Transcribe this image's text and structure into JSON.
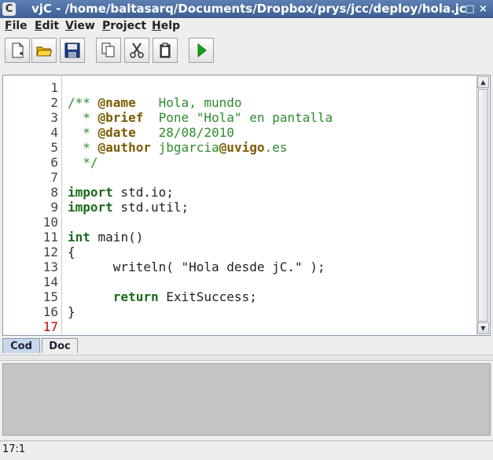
{
  "window": {
    "app_icon": "C",
    "title": "vjC - /home/baltasarq/Documents/Dropbox/prys/jcc/deploy/hola.jc",
    "controls": [
      "_",
      "□",
      "×"
    ]
  },
  "menu": [
    {
      "key": "F",
      "rest": "ile"
    },
    {
      "key": "E",
      "rest": "dit"
    },
    {
      "key": "V",
      "rest": "iew"
    },
    {
      "key": "P",
      "rest": "roject"
    },
    {
      "key": "H",
      "rest": "elp"
    }
  ],
  "toolbar": {
    "icons": [
      "new-file-icon",
      "open-folder-icon",
      "save-icon",
      "copy-icon",
      "cut-icon",
      "paste-icon",
      "run-icon"
    ]
  },
  "editor": {
    "line_numbers": [
      "1",
      "2",
      "3",
      "4",
      "5",
      "6",
      "7",
      "8",
      "9",
      "10",
      "11",
      "12",
      "13",
      "14",
      "15",
      "16",
      "17"
    ],
    "current_line": "17",
    "lines": [
      "",
      "/** @name   Hola, mundo",
      "  * @brief  Pone \"Hola\" en pantalla",
      "  * @date   28/08/2010",
      "  * @author jbgarcia@uvigo.es",
      "  */",
      "",
      "import std.io;",
      "import std.util;",
      "",
      "int main()",
      "{",
      "      writeln( \"Hola desde jC.\" );",
      "",
      "      return ExitSuccess;",
      "}",
      ""
    ]
  },
  "tabs": [
    "Cod",
    "Doc"
  ],
  "status": {
    "position": "17:1"
  },
  "colors": {
    "title_bar": "#4a6ea5",
    "current_line_number": "#cc0000",
    "active_tab": "#c8d7ea",
    "output_panel": "#c4c4c4"
  }
}
